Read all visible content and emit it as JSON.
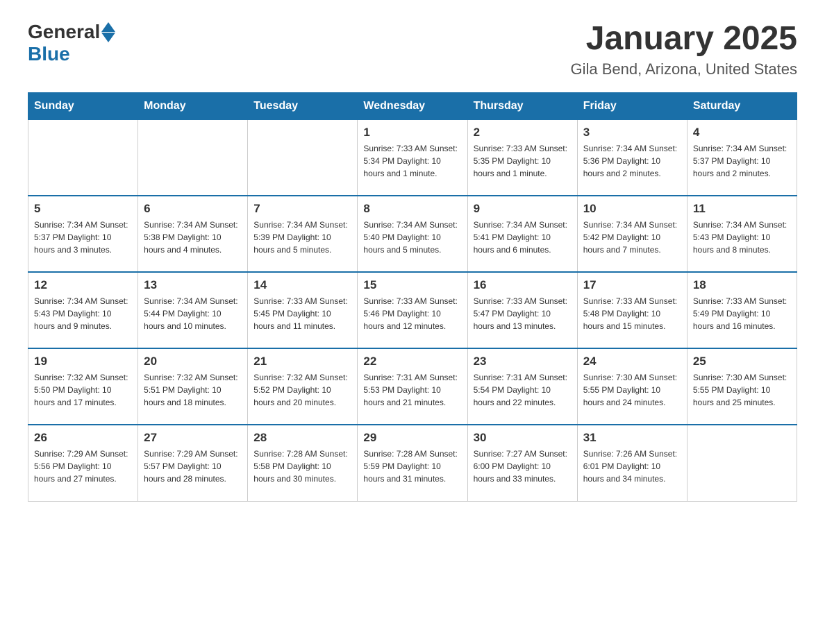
{
  "header": {
    "logo_general": "General",
    "logo_blue": "Blue",
    "title": "January 2025",
    "subtitle": "Gila Bend, Arizona, United States"
  },
  "days_of_week": [
    "Sunday",
    "Monday",
    "Tuesday",
    "Wednesday",
    "Thursday",
    "Friday",
    "Saturday"
  ],
  "weeks": [
    [
      {
        "day": "",
        "info": ""
      },
      {
        "day": "",
        "info": ""
      },
      {
        "day": "",
        "info": ""
      },
      {
        "day": "1",
        "info": "Sunrise: 7:33 AM\nSunset: 5:34 PM\nDaylight: 10 hours and 1 minute."
      },
      {
        "day": "2",
        "info": "Sunrise: 7:33 AM\nSunset: 5:35 PM\nDaylight: 10 hours and 1 minute."
      },
      {
        "day": "3",
        "info": "Sunrise: 7:34 AM\nSunset: 5:36 PM\nDaylight: 10 hours and 2 minutes."
      },
      {
        "day": "4",
        "info": "Sunrise: 7:34 AM\nSunset: 5:37 PM\nDaylight: 10 hours and 2 minutes."
      }
    ],
    [
      {
        "day": "5",
        "info": "Sunrise: 7:34 AM\nSunset: 5:37 PM\nDaylight: 10 hours and 3 minutes."
      },
      {
        "day": "6",
        "info": "Sunrise: 7:34 AM\nSunset: 5:38 PM\nDaylight: 10 hours and 4 minutes."
      },
      {
        "day": "7",
        "info": "Sunrise: 7:34 AM\nSunset: 5:39 PM\nDaylight: 10 hours and 5 minutes."
      },
      {
        "day": "8",
        "info": "Sunrise: 7:34 AM\nSunset: 5:40 PM\nDaylight: 10 hours and 5 minutes."
      },
      {
        "day": "9",
        "info": "Sunrise: 7:34 AM\nSunset: 5:41 PM\nDaylight: 10 hours and 6 minutes."
      },
      {
        "day": "10",
        "info": "Sunrise: 7:34 AM\nSunset: 5:42 PM\nDaylight: 10 hours and 7 minutes."
      },
      {
        "day": "11",
        "info": "Sunrise: 7:34 AM\nSunset: 5:43 PM\nDaylight: 10 hours and 8 minutes."
      }
    ],
    [
      {
        "day": "12",
        "info": "Sunrise: 7:34 AM\nSunset: 5:43 PM\nDaylight: 10 hours and 9 minutes."
      },
      {
        "day": "13",
        "info": "Sunrise: 7:34 AM\nSunset: 5:44 PM\nDaylight: 10 hours and 10 minutes."
      },
      {
        "day": "14",
        "info": "Sunrise: 7:33 AM\nSunset: 5:45 PM\nDaylight: 10 hours and 11 minutes."
      },
      {
        "day": "15",
        "info": "Sunrise: 7:33 AM\nSunset: 5:46 PM\nDaylight: 10 hours and 12 minutes."
      },
      {
        "day": "16",
        "info": "Sunrise: 7:33 AM\nSunset: 5:47 PM\nDaylight: 10 hours and 13 minutes."
      },
      {
        "day": "17",
        "info": "Sunrise: 7:33 AM\nSunset: 5:48 PM\nDaylight: 10 hours and 15 minutes."
      },
      {
        "day": "18",
        "info": "Sunrise: 7:33 AM\nSunset: 5:49 PM\nDaylight: 10 hours and 16 minutes."
      }
    ],
    [
      {
        "day": "19",
        "info": "Sunrise: 7:32 AM\nSunset: 5:50 PM\nDaylight: 10 hours and 17 minutes."
      },
      {
        "day": "20",
        "info": "Sunrise: 7:32 AM\nSunset: 5:51 PM\nDaylight: 10 hours and 18 minutes."
      },
      {
        "day": "21",
        "info": "Sunrise: 7:32 AM\nSunset: 5:52 PM\nDaylight: 10 hours and 20 minutes."
      },
      {
        "day": "22",
        "info": "Sunrise: 7:31 AM\nSunset: 5:53 PM\nDaylight: 10 hours and 21 minutes."
      },
      {
        "day": "23",
        "info": "Sunrise: 7:31 AM\nSunset: 5:54 PM\nDaylight: 10 hours and 22 minutes."
      },
      {
        "day": "24",
        "info": "Sunrise: 7:30 AM\nSunset: 5:55 PM\nDaylight: 10 hours and 24 minutes."
      },
      {
        "day": "25",
        "info": "Sunrise: 7:30 AM\nSunset: 5:55 PM\nDaylight: 10 hours and 25 minutes."
      }
    ],
    [
      {
        "day": "26",
        "info": "Sunrise: 7:29 AM\nSunset: 5:56 PM\nDaylight: 10 hours and 27 minutes."
      },
      {
        "day": "27",
        "info": "Sunrise: 7:29 AM\nSunset: 5:57 PM\nDaylight: 10 hours and 28 minutes."
      },
      {
        "day": "28",
        "info": "Sunrise: 7:28 AM\nSunset: 5:58 PM\nDaylight: 10 hours and 30 minutes."
      },
      {
        "day": "29",
        "info": "Sunrise: 7:28 AM\nSunset: 5:59 PM\nDaylight: 10 hours and 31 minutes."
      },
      {
        "day": "30",
        "info": "Sunrise: 7:27 AM\nSunset: 6:00 PM\nDaylight: 10 hours and 33 minutes."
      },
      {
        "day": "31",
        "info": "Sunrise: 7:26 AM\nSunset: 6:01 PM\nDaylight: 10 hours and 34 minutes."
      },
      {
        "day": "",
        "info": ""
      }
    ]
  ]
}
